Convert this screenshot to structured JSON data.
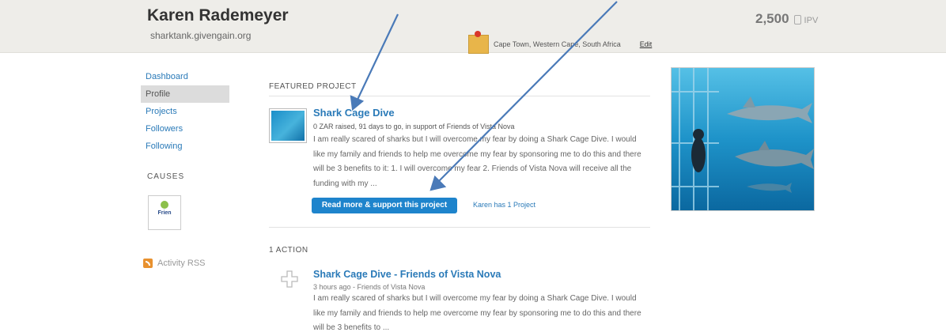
{
  "header": {
    "profile_name": "Karen Rademeyer",
    "profile_url": "sharktank.givengain.org",
    "location": "Cape Town, Western Cape, South Africa",
    "edit_label": "Edit",
    "points_value": "2,500",
    "points_unit": "IPV"
  },
  "sidebar": {
    "items": [
      {
        "label": "Dashboard"
      },
      {
        "label": "Profile"
      },
      {
        "label": "Projects"
      },
      {
        "label": "Followers"
      },
      {
        "label": "Following"
      }
    ],
    "causes_title": "CAUSES",
    "cause_logo_text": "Frien",
    "activity_label": "Activity RSS"
  },
  "featured": {
    "section_title": "FEATURED PROJECT",
    "project_title": "Shark Cage Dive",
    "meta": "0 ZAR raised, 91 days to go, in support of Friends of Vista Nova",
    "description": "I am really scared of sharks but I will overcome my fear by doing a Shark Cage Dive. I would like my family and friends to help me overcome my fear by sponsoring me to do this and there will be 3 benefits to it: 1. I will overcome my fear 2. Friends of Vista Nova will receive all the funding with my ...",
    "support_button": "Read more & support this project",
    "projects_count": "Karen has 1 Project"
  },
  "actions": {
    "section_title": "1 ACTION",
    "items": [
      {
        "title": "Shark Cage Dive - Friends of Vista Nova",
        "meta": "3 hours ago - Friends of Vista Nova",
        "description": "I am really scared of sharks but I will overcome my fear by doing a Shark Cage Dive. I would like my family and friends to help me overcome my fear by sponsoring me to do this and there will be 3 benefits to ..."
      }
    ]
  },
  "colors": {
    "header_bg": "#eeede9",
    "link_blue": "#2a7ab8",
    "button_blue": "#1e84cc",
    "arrow_blue": "#4a7ab8"
  },
  "icons": {
    "location": "map-pin-icon",
    "rss": "rss-icon",
    "action": "plus-icon"
  }
}
